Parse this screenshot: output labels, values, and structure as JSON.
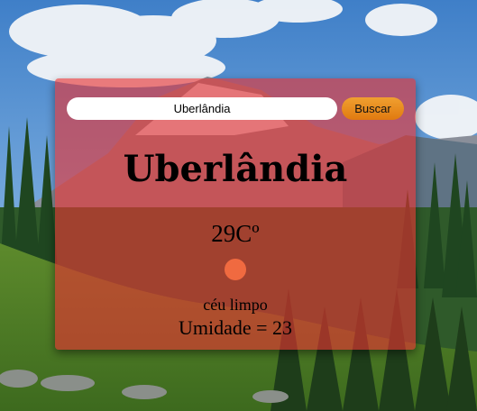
{
  "search": {
    "value": "Uberlândia",
    "button_label": "Buscar"
  },
  "weather": {
    "city": "Uberlândia",
    "temperature": "29Cº",
    "description": "céu limpo",
    "humidity": "Umidade = 23",
    "icon": "clear-sky-icon"
  },
  "colors": {
    "card_overlay": "#e83232",
    "button": "#e88a20",
    "icon": "#f06a40"
  }
}
